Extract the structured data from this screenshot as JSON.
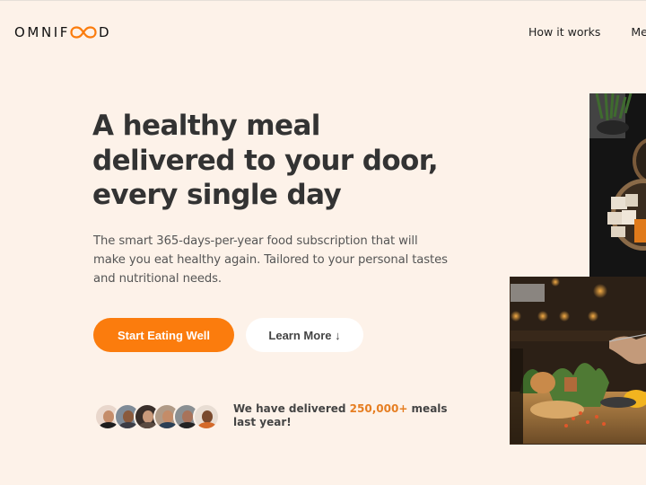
{
  "header": {
    "logo": {
      "prefix": "OMNIF",
      "suffix": "D",
      "accent_color": "#fb7c0d"
    },
    "nav": [
      {
        "label": "How it works"
      },
      {
        "label": "Meals"
      }
    ]
  },
  "hero": {
    "title": "A healthy meal delivered to your door, every single day",
    "description": "The smart 365-days-per-year food subscription that will make you eat healthy again. Tailored to your personal tastes and nutritional needs.",
    "primary_button": "Start Eating Well",
    "secondary_button": "Learn More ↓",
    "delivered": {
      "prefix": "We have delivered ",
      "highlight": "250,000+",
      "suffix": " meals last year!"
    },
    "customer_avatars": [
      {
        "name": "customer-1"
      },
      {
        "name": "customer-2"
      },
      {
        "name": "customer-3"
      },
      {
        "name": "customer-4"
      },
      {
        "name": "customer-5"
      },
      {
        "name": "customer-6"
      }
    ],
    "images": [
      {
        "alt": "Bowls of healthy food on a dark table"
      },
      {
        "alt": "Person eating at a cozy cafe table with plants"
      }
    ]
  },
  "colors": {
    "background": "#fdf2e9",
    "primary": "#fb7c0d",
    "highlight_text": "#e67e22",
    "heading": "#333333"
  }
}
